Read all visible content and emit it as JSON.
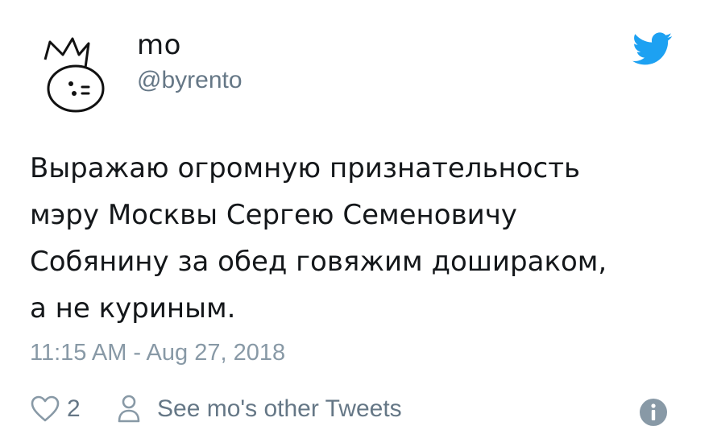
{
  "author": {
    "display_name": "mo",
    "handle": "@byrento",
    "avatar_icon": "crowned-face-avatar"
  },
  "tweet": {
    "lines": [
      "Выражаю огромную признательность",
      "мэру Москвы Сергею Семеновичу",
      "Собянину за обед говяжим дошираком,",
      "а не куриным."
    ],
    "timestamp": "11:15 AM - Aug 27, 2018"
  },
  "actions": {
    "like_icon": "heart-icon",
    "like_count": "2",
    "profile_icon": "person-icon",
    "profile_label": "See mo's other Tweets",
    "info_icon": "info-icon"
  },
  "brand": {
    "logo": "twitter-bird-icon",
    "color": "#1da1f2"
  },
  "colors": {
    "text": "#14171a",
    "secondary": "#657786",
    "timestamp": "#8899a6"
  }
}
